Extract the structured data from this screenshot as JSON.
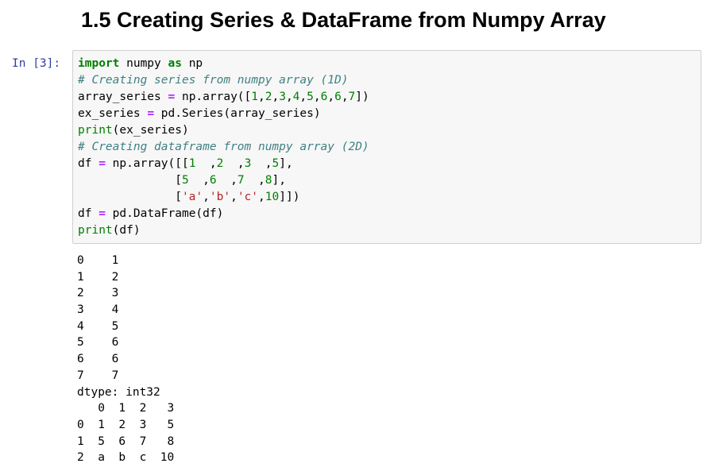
{
  "heading": "1.5  Creating Series & DataFrame from Numpy Array",
  "cell": {
    "prompt": "In [3]:",
    "code_lines": [
      [
        {
          "t": "import",
          "c": "kw"
        },
        {
          "t": " numpy ",
          "c": ""
        },
        {
          "t": "as",
          "c": "kw"
        },
        {
          "t": " np",
          "c": ""
        }
      ],
      [
        {
          "t": "# Creating series from numpy array (1D)",
          "c": "cm"
        }
      ],
      [
        {
          "t": "array_series ",
          "c": ""
        },
        {
          "t": "=",
          "c": "op"
        },
        {
          "t": " np.array([",
          "c": ""
        },
        {
          "t": "1",
          "c": "num"
        },
        {
          "t": ",",
          "c": ""
        },
        {
          "t": "2",
          "c": "num"
        },
        {
          "t": ",",
          "c": ""
        },
        {
          "t": "3",
          "c": "num"
        },
        {
          "t": ",",
          "c": ""
        },
        {
          "t": "4",
          "c": "num"
        },
        {
          "t": ",",
          "c": ""
        },
        {
          "t": "5",
          "c": "num"
        },
        {
          "t": ",",
          "c": ""
        },
        {
          "t": "6",
          "c": "num"
        },
        {
          "t": ",",
          "c": ""
        },
        {
          "t": "6",
          "c": "num"
        },
        {
          "t": ",",
          "c": ""
        },
        {
          "t": "7",
          "c": "num"
        },
        {
          "t": "])",
          "c": ""
        }
      ],
      [
        {
          "t": "ex_series ",
          "c": ""
        },
        {
          "t": "=",
          "c": "op"
        },
        {
          "t": " pd.Series(array_series)",
          "c": ""
        }
      ],
      [
        {
          "t": "print",
          "c": "bi"
        },
        {
          "t": "(ex_series)",
          "c": ""
        }
      ],
      [
        {
          "t": "# Creating dataframe from numpy array (2D)",
          "c": "cm"
        }
      ],
      [
        {
          "t": "df ",
          "c": ""
        },
        {
          "t": "=",
          "c": "op"
        },
        {
          "t": " np.array([[",
          "c": ""
        },
        {
          "t": "1",
          "c": "num"
        },
        {
          "t": "  ,",
          "c": ""
        },
        {
          "t": "2",
          "c": "num"
        },
        {
          "t": "  ,",
          "c": ""
        },
        {
          "t": "3",
          "c": "num"
        },
        {
          "t": "  ,",
          "c": ""
        },
        {
          "t": "5",
          "c": "num"
        },
        {
          "t": "],",
          "c": ""
        }
      ],
      [
        {
          "t": "              [",
          "c": ""
        },
        {
          "t": "5",
          "c": "num"
        },
        {
          "t": "  ,",
          "c": ""
        },
        {
          "t": "6",
          "c": "num"
        },
        {
          "t": "  ,",
          "c": ""
        },
        {
          "t": "7",
          "c": "num"
        },
        {
          "t": "  ,",
          "c": ""
        },
        {
          "t": "8",
          "c": "num"
        },
        {
          "t": "],",
          "c": ""
        }
      ],
      [
        {
          "t": "              [",
          "c": ""
        },
        {
          "t": "'a'",
          "c": "str"
        },
        {
          "t": ",",
          "c": ""
        },
        {
          "t": "'b'",
          "c": "str"
        },
        {
          "t": ",",
          "c": ""
        },
        {
          "t": "'c'",
          "c": "str"
        },
        {
          "t": ",",
          "c": ""
        },
        {
          "t": "10",
          "c": "num"
        },
        {
          "t": "]])",
          "c": ""
        }
      ],
      [
        {
          "t": "df ",
          "c": ""
        },
        {
          "t": "=",
          "c": "op"
        },
        {
          "t": " pd.DataFrame(df)",
          "c": ""
        }
      ],
      [
        {
          "t": "print",
          "c": "bi"
        },
        {
          "t": "(df)",
          "c": ""
        }
      ]
    ],
    "output_lines": [
      "0    1",
      "1    2",
      "2    3",
      "3    4",
      "4    5",
      "5    6",
      "6    6",
      "7    7",
      "dtype: int32",
      "   0  1  2   3",
      "0  1  2  3   5",
      "1  5  6  7   8",
      "2  a  b  c  10"
    ]
  }
}
